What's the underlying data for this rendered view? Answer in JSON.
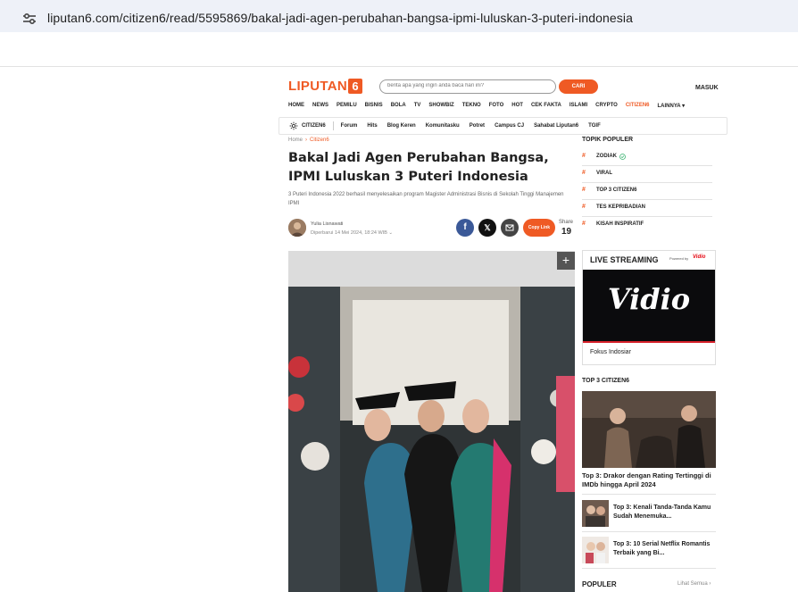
{
  "browser": {
    "url": "liputan6.com/citizen6/read/5595869/bakal-jadi-agen-perubahan-bangsa-ipmi-luluskan-3-puteri-indonesia"
  },
  "header": {
    "logo_text": "LIPUTAN",
    "logo_number": "6",
    "search_placeholder": "berita apa yang ingin anda baca hari ini?",
    "search_button": "CARI",
    "login": "MASUK",
    "brand_color": "#ef5a24"
  },
  "main_nav": [
    "HOME",
    "NEWS",
    "PEMILU",
    "BISNIS",
    "BOLA",
    "TV",
    "SHOWBIZ",
    "TEKNO",
    "FOTO",
    "HOT",
    "CEK FAKTA",
    "ISLAMI",
    "CRYPTO",
    "CITIZEN6",
    "LAINNYA ▾"
  ],
  "active_nav": "CITIZEN6",
  "sub_nav": {
    "label": "CITIZEN6",
    "items": [
      "Forum",
      "Hits",
      "Blog Keren",
      "Komunitasku",
      "Potret",
      "Campus CJ",
      "Sahabat Liputan6",
      "TGIF"
    ]
  },
  "article": {
    "breadcrumb": [
      "Home",
      "Citizen6"
    ],
    "title": "Bakal Jadi Agen Perubahan Bangsa, IPMI Luluskan 3 Puteri Indonesia",
    "description": "3 Puteri Indonesia 2022 berhasil menyelesaikan program Magister Administrasi Bisnis di Sekolah Tinggi Manajemen IPMI",
    "author": "Yulia Lisnawati",
    "date": "Diperbarui 14 Mei 2024, 18:24 WIB ⌄",
    "copy_link": "Copy Link",
    "share_label": "Share",
    "share_count": "19"
  },
  "sidebar": {
    "topik_head": "TOPIK POPULER",
    "topik": [
      "ZODIAK",
      "VIRAL",
      "TOP 3 CITIZEN6",
      "TES KEPRIBADIAN",
      "KISAH INSPIRATIF"
    ],
    "live_title": "LIVE STREAMING",
    "live_powered": "Powered by",
    "live_brand": "Vidio",
    "live_caption": "Fokus Indosiar",
    "top3_head": "TOP 3 CITIZEN6",
    "top3_main": "Top 3: Drakor dengan Rating Tertinggi di IMDb hingga April 2024",
    "top3_items": [
      "Top 3: Kenali Tanda-Tanda Kamu Sudah Menemuka...",
      "Top 3: 10 Serial Netflix Romantis Terbaik yang Bi..."
    ],
    "populer_head": "POPULER",
    "see_all": "Lihat Semua ›"
  }
}
